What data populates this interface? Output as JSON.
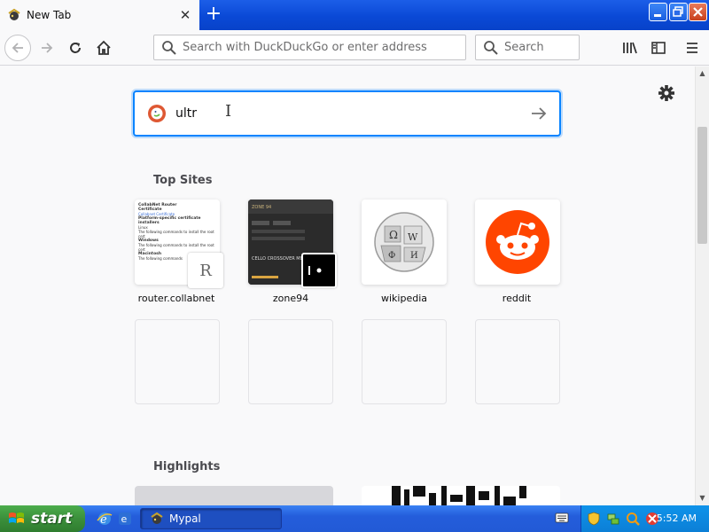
{
  "browser": {
    "tab_title": "New Tab",
    "tab_close": "✕",
    "new_tab": "+",
    "url_placeholder": "Search with DuckDuckGo or enter address",
    "search_placeholder": "Search"
  },
  "page": {
    "search_value": "ultr",
    "top_sites_title": "Top Sites",
    "highlights_title": "Highlights",
    "top_sites": [
      {
        "label": "router.collabnet",
        "badge": "R"
      },
      {
        "label": "zone94"
      },
      {
        "label": "wikipedia"
      },
      {
        "label": "reddit"
      }
    ],
    "router_thumb_lines": [
      "CollabNet Router",
      "Certificate",
      "Collabnet Certificate",
      "Platform-specific certificate installers",
      "Linux",
      "The following commands to install the root cert",
      "Windows",
      "The following commands to install the root cert",
      "Macintosh",
      "The following commands"
    ],
    "zone_thumb": {
      "brand": "ZONE 94",
      "headline": "CELLO CROSSOVER MET AND METAL"
    }
  },
  "taskbar": {
    "start_label": "start",
    "task_label": "Mypal",
    "clock": "5:52 AM"
  },
  "colors": {
    "accent": "#0a84ff",
    "reddit": "#ff4500",
    "ddg": "#de5833",
    "taskbar": "#245ddb",
    "start": "#3b8f3b"
  }
}
